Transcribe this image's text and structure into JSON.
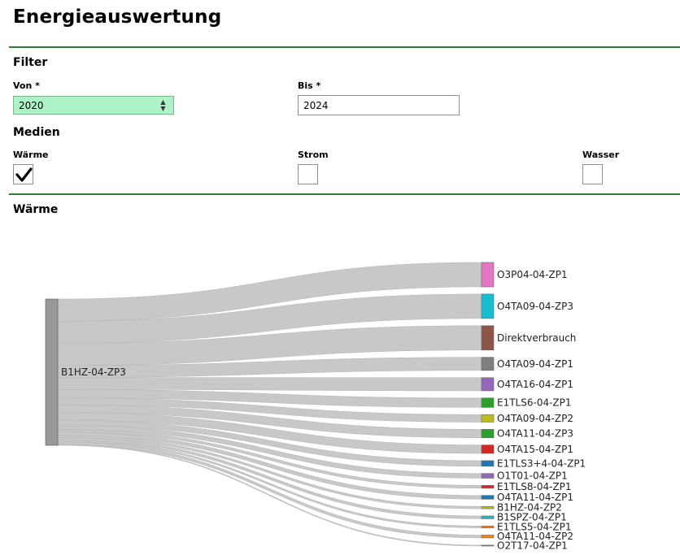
{
  "page": {
    "title": "Energieauswertung"
  },
  "filter": {
    "heading": "Filter",
    "von_label": "Von *",
    "von_value": "2020",
    "bis_label": "Bis *",
    "bis_value": "2024"
  },
  "medien": {
    "heading": "Medien",
    "waerme_label": "Wärme",
    "waerme_checked": true,
    "strom_label": "Strom",
    "strom_checked": false,
    "wasser_label": "Wasser",
    "wasser_checked": false
  },
  "chart_section": {
    "heading": "Wärme"
  },
  "chart_data": {
    "type": "sankey",
    "source": {
      "name": "B1HZ-04-ZP3",
      "color": "#999999"
    },
    "targets": [
      {
        "name": "O3P04-04-ZP1",
        "value": 26,
        "color": "#e377c2"
      },
      {
        "name": "O4TA09-04-ZP3",
        "value": 26,
        "color": "#17becf"
      },
      {
        "name": "Direktverbrauch",
        "value": 26,
        "color": "#8c564b"
      },
      {
        "name": "O4TA09-04-ZP1",
        "value": 14,
        "color": "#7f7f7f"
      },
      {
        "name": "O4TA16-04-ZP1",
        "value": 14,
        "color": "#9467bd"
      },
      {
        "name": "E1TLS6-04-ZP1",
        "value": 10,
        "color": "#2ca02c"
      },
      {
        "name": "O4TA09-04-ZP2",
        "value": 8,
        "color": "#bcbd22"
      },
      {
        "name": "O4TA11-04-ZP3",
        "value": 9,
        "color": "#2ca02c"
      },
      {
        "name": "O4TA15-04-ZP1",
        "value": 9,
        "color": "#d62728"
      },
      {
        "name": "E1TLS3+4-04-ZP1",
        "value": 6,
        "color": "#1f77b4"
      },
      {
        "name": "O1T01-04-ZP1",
        "value": 5,
        "color": "#9467bd"
      },
      {
        "name": "E1TLS8-04-ZP1",
        "value": 3,
        "color": "#d62728"
      },
      {
        "name": "O4TA11-04-ZP1",
        "value": 4,
        "color": "#1f77b4"
      },
      {
        "name": "B1HZ-04-ZP2",
        "value": 2.5,
        "color": "#bcbd22"
      },
      {
        "name": "B1SPZ-04-ZP1",
        "value": 3,
        "color": "#17becf"
      },
      {
        "name": "E1TLS5-04-ZP1",
        "value": 2,
        "color": "#ff7f0e"
      },
      {
        "name": "O4TA11-04-ZP2",
        "value": 3,
        "color": "#ff7f0e"
      },
      {
        "name": "O2T17-04-ZP1",
        "value": 1,
        "color": "#7f7f7f"
      }
    ]
  }
}
